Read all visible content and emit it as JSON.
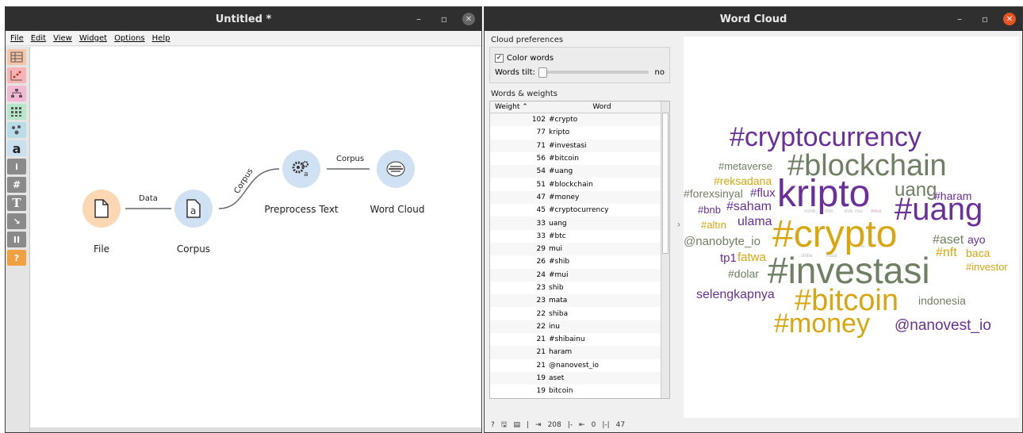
{
  "left_window": {
    "title": "Untitled *",
    "menu": [
      "File",
      "Edit",
      "View",
      "Widget",
      "Options",
      "Help"
    ],
    "toolbox": [
      {
        "icon": "table-icon",
        "color": "#f6c4a7"
      },
      {
        "icon": "scatter-icon",
        "color": "#f8b4b4"
      },
      {
        "icon": "tree-icon",
        "color": "#f4b8d4"
      },
      {
        "icon": "grid-icon",
        "color": "#b8e6c8"
      },
      {
        "icon": "cluster-icon",
        "color": "#b8dce8"
      },
      {
        "icon": "text-a-icon",
        "glyph": "a",
        "color": "#c8e0f0"
      },
      {
        "icon": "info-icon",
        "glyph": "i",
        "color": "#8a8a8a"
      },
      {
        "icon": "hash-icon",
        "glyph": "#",
        "color": "#8a8a8a"
      },
      {
        "icon": "text-t-icon",
        "glyph": "T",
        "color": "#8a8a8a"
      },
      {
        "icon": "arrow-icon",
        "glyph": "↘",
        "color": "#8a8a8a"
      },
      {
        "icon": "pause-icon",
        "glyph": "II",
        "color": "#8a8a8a"
      },
      {
        "icon": "help-icon",
        "glyph": "?",
        "color": "#f0a040"
      }
    ],
    "nodes": [
      {
        "label": "File",
        "icon": "file-icon",
        "color": "#fcd7b4"
      },
      {
        "label": "Corpus",
        "icon": "corpus-icon",
        "color": "#cfe1f2"
      },
      {
        "label": "Preprocess Text",
        "icon": "gears-icon",
        "color": "#cfe1f2"
      },
      {
        "label": "Word Cloud",
        "icon": "word-cloud-icon",
        "color": "#cfe1f2"
      }
    ],
    "links": [
      "Data",
      "Corpus",
      "Corpus"
    ]
  },
  "right_window": {
    "title": "Word Cloud",
    "cloud_preferences_title": "Cloud preferences",
    "color_words_label": "Color words",
    "color_words_checked": true,
    "words_tilt_label": "Words tilt:",
    "words_tilt_value": "no",
    "words_weights_title": "Words & weights",
    "table_headers": {
      "weight": "Weight",
      "word": "Word"
    },
    "table_rows": [
      {
        "weight": "102",
        "word": "#crypto"
      },
      {
        "weight": "77",
        "word": "kripto"
      },
      {
        "weight": "71",
        "word": "#investasi"
      },
      {
        "weight": "56",
        "word": "#bitcoin"
      },
      {
        "weight": "54",
        "word": "#uang"
      },
      {
        "weight": "51",
        "word": "#blockchain"
      },
      {
        "weight": "47",
        "word": "#money"
      },
      {
        "weight": "45",
        "word": "#cryptocurrency"
      },
      {
        "weight": "33",
        "word": "uang"
      },
      {
        "weight": "33",
        "word": "#btc"
      },
      {
        "weight": "29",
        "word": "mui"
      },
      {
        "weight": "26",
        "word": "#shib"
      },
      {
        "weight": "24",
        "word": "#mui"
      },
      {
        "weight": "23",
        "word": "shib"
      },
      {
        "weight": "23",
        "word": "mata"
      },
      {
        "weight": "22",
        "word": "shiba"
      },
      {
        "weight": "22",
        "word": "inu"
      },
      {
        "weight": "21",
        "word": "#shibainu"
      },
      {
        "weight": "21",
        "word": "haram"
      },
      {
        "weight": "21",
        "word": "@nanovest_io"
      },
      {
        "weight": "19",
        "word": "aset"
      },
      {
        "weight": "19",
        "word": "bitcoin"
      }
    ],
    "status": {
      "in": "208",
      "out_selected": "0",
      "out_total": "47"
    },
    "colors": {
      "purple": "#6a2f9a",
      "green": "#6f8062",
      "gold": "#d9a610"
    },
    "cloud_words": [
      {
        "text": "#cryptocurrency",
        "color": "purple"
      },
      {
        "text": "#metaverse",
        "color": "green"
      },
      {
        "text": "#blockchain",
        "color": "green"
      },
      {
        "text": "#reksadana",
        "color": "gold"
      },
      {
        "text": "#forexsinyal",
        "color": "green"
      },
      {
        "text": "#flux",
        "color": "purple"
      },
      {
        "text": "kripto",
        "color": "purple"
      },
      {
        "text": "uang",
        "color": "green"
      },
      {
        "text": "#haram",
        "color": "purple"
      },
      {
        "text": "#bnb",
        "color": "purple"
      },
      {
        "text": "#saham",
        "color": "purple"
      },
      {
        "text": "#uang",
        "color": "purple"
      },
      {
        "text": "#altın",
        "color": "gold"
      },
      {
        "text": "ulama",
        "color": "purple"
      },
      {
        "text": "@nanobyte_io",
        "color": "green"
      },
      {
        "text": "#crypto",
        "color": "gold"
      },
      {
        "text": "#aset",
        "color": "green"
      },
      {
        "text": "ayo",
        "color": "purple"
      },
      {
        "text": "tp1",
        "color": "purple"
      },
      {
        "text": "fatwa",
        "color": "gold"
      },
      {
        "text": "#nft",
        "color": "gold"
      },
      {
        "text": "baca",
        "color": "gold"
      },
      {
        "text": "#dolar",
        "color": "green"
      },
      {
        "text": "#investasi",
        "color": "green"
      },
      {
        "text": "#investor",
        "color": "gold"
      },
      {
        "text": "selengkapnya",
        "color": "purple"
      },
      {
        "text": "#bitcoin",
        "color": "gold"
      },
      {
        "text": "indonesia",
        "color": "green"
      },
      {
        "text": "#money",
        "color": "gold"
      },
      {
        "text": "@nanovest_io",
        "color": "purple"
      }
    ]
  }
}
